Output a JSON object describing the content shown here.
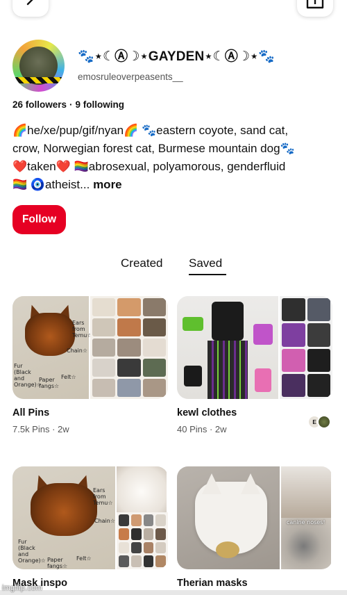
{
  "profile": {
    "display_name": "🐾⋆☾Ⓐ☽⋆GAYDEN⋆☾Ⓐ☽⋆🐾",
    "username": "emosruleoverpeasents__",
    "followers": "26 followers",
    "following": "9 following",
    "bio_lines": [
      "🌈he/xe/pup/gif/nyan🌈 🐾eastern coyote, sand cat,",
      "crow, Norwegian forest cat, Burmese mountain dog🐾",
      "❤️taken❤️ 🏳️‍🌈abrosexual, polyamorous, genderfluid",
      "🏳️‍🌈 🧿atheist..."
    ],
    "bio_more": "more",
    "follow_label": "Follow"
  },
  "tabs": {
    "created": "Created",
    "saved": "Saved"
  },
  "boards": [
    {
      "title": "All Pins",
      "meta": "7.5k Pins · 2w"
    },
    {
      "title": "kewl clothes",
      "meta": "40 Pins · 2w"
    },
    {
      "title": "Mask inspo"
    },
    {
      "title": "Therian masks"
    }
  ],
  "cover_notes": {
    "ears": "Ears from Temu☆",
    "chain": "Chain☆",
    "fur": "Fur (Black and Orange)☆",
    "fangs": "Paper fangs☆",
    "felt": "Felt☆",
    "canine": "canine noses!"
  },
  "collab_initial": "E",
  "watermark": "imgflip.com",
  "colors": {
    "follow_button": "#e60023",
    "text": "#111111",
    "muted": "#555555"
  },
  "icons": {
    "back": "chevron-left-icon",
    "share": "share-icon"
  }
}
